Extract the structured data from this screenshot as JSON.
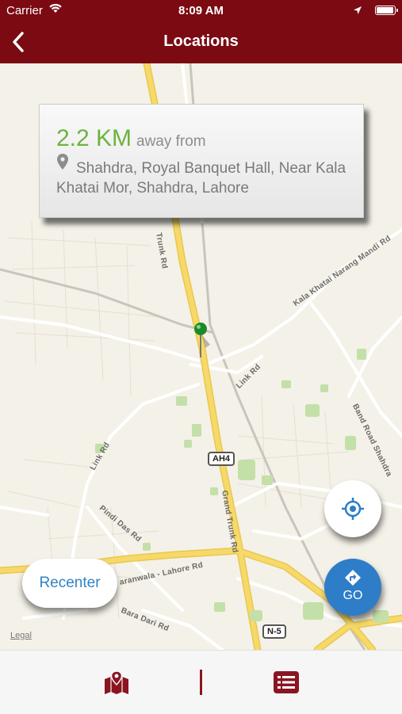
{
  "status_bar": {
    "carrier": "Carrier",
    "time": "8:09 AM",
    "battery_level": 0.95
  },
  "nav_bar": {
    "title": "Locations",
    "back_icon": "chevron-left-icon"
  },
  "map": {
    "road_labels": {
      "trunk_rd_upper": "Trunk Rd",
      "kala_khatai": "Kala Khatai Narang Mandi Rd",
      "link_rd_right": "Link Rd",
      "band_road": "Band Road Shahdra",
      "link_rd_left": "Link Rd",
      "grand_trunk": "Grand Trunk Rd",
      "pindi_das": "Pindi Das Rd",
      "sheikhupura": "aranwala - Lahore Rd",
      "bara_dari": "Bara Dari Rd"
    },
    "shields": {
      "ah4": "AH4",
      "n5": "N-5"
    },
    "legal": "Legal",
    "pin_icon": "map-pin-icon",
    "colors": {
      "major_road": "#f7d96a",
      "minor_road": "#ffffff",
      "park": "#c3e0a8",
      "background": "#f4f1e8"
    }
  },
  "info_card": {
    "distance": "2.2 KM",
    "away_label": "away from",
    "address": "Shahdra, Royal Banquet Hall, Near Kala Khatai Mor, Shahdra, Lahore",
    "pin_icon": "location-pin-icon"
  },
  "buttons": {
    "recenter": "Recenter",
    "gps_icon": "crosshair-icon",
    "go_label": "GO",
    "go_icon": "directions-arrow-icon"
  },
  "tab_bar": {
    "map_icon": "map-icon",
    "list_icon": "list-icon"
  },
  "colors": {
    "brand": "#7b0a13",
    "accent_blue": "#2e7dc8",
    "distance_green": "#6db33f"
  }
}
